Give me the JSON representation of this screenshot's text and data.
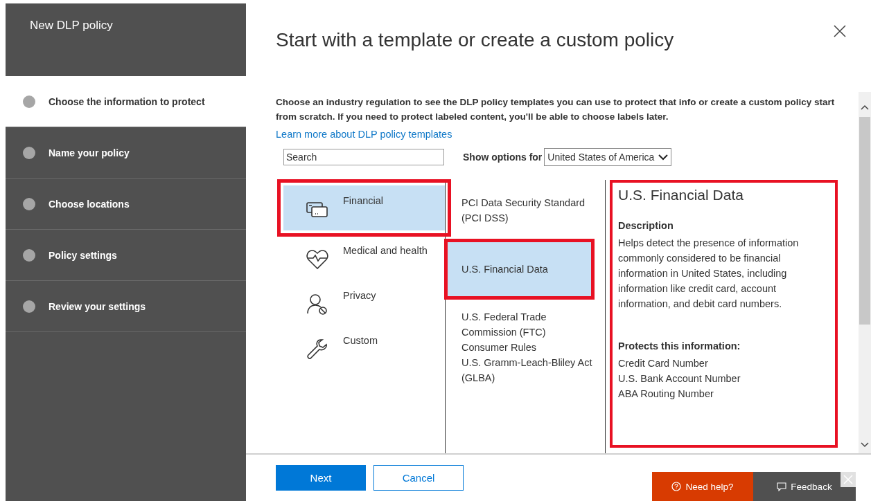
{
  "sidebar": {
    "title": "New DLP policy",
    "steps": [
      {
        "label": "Choose the information to protect",
        "selected": true
      },
      {
        "label": "Name your policy",
        "selected": false
      },
      {
        "label": "Choose locations",
        "selected": false
      },
      {
        "label": "Policy settings",
        "selected": false
      },
      {
        "label": "Review your settings",
        "selected": false
      }
    ]
  },
  "title": "Start with a template or create a custom policy",
  "intro": "Choose an industry regulation to see the DLP policy templates you can use to protect that info or create a custom policy start from scratch. If you need to protect labeled content, you'll be able to choose labels later.",
  "learn_more_link": "Learn more about DLP policy templates",
  "search": {
    "placeholder": "Search"
  },
  "show_options": {
    "label": "Show options for",
    "value": "United States of America"
  },
  "categories": [
    {
      "label": "Financial",
      "kind": "card",
      "selected": true,
      "highlighted": true
    },
    {
      "label": "Medical and health",
      "kind": "heart",
      "selected": false,
      "highlighted": false
    },
    {
      "label": "Privacy",
      "kind": "person",
      "selected": false,
      "highlighted": false
    },
    {
      "label": "Custom",
      "kind": "wrench",
      "selected": false,
      "highlighted": false
    }
  ],
  "templates": [
    {
      "label": "PCI Data Security Standard (PCI DSS)",
      "selected": false,
      "highlighted": false
    },
    {
      "label": "U.S. Financial Data",
      "selected": true,
      "highlighted": true
    },
    {
      "label": "U.S. Federal Trade Commission (FTC) Consumer Rules",
      "selected": false,
      "highlighted": false
    },
    {
      "label": "U.S. Gramm-Leach-Bliley Act (GLBA)",
      "selected": false,
      "highlighted": false
    }
  ],
  "details": {
    "highlighted": true,
    "title": "U.S. Financial Data",
    "description_heading": "Description",
    "description": "Helps detect the presence of information commonly considered to be financial information in United States, including information like credit card, account information, and debit card numbers.",
    "protects_heading": "Protects this information:",
    "protects": [
      "Credit Card Number",
      "U.S. Bank Account Number",
      "ABA Routing Number"
    ]
  },
  "buttons": [
    {
      "label": "Next",
      "kind": "primary"
    },
    {
      "label": "Cancel",
      "kind": "secondary"
    }
  ],
  "help": {
    "need_help": "Need help?",
    "feedback": "Feedback"
  }
}
